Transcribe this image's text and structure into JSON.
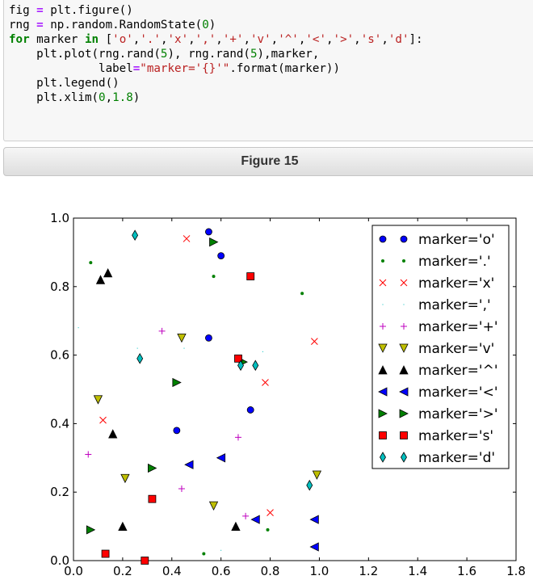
{
  "code": {
    "lines": [
      [
        {
          "t": "fig "
        },
        {
          "t": "=",
          "c": "op"
        },
        {
          "t": " plt.figure()"
        }
      ],
      [
        {
          "t": "rng "
        },
        {
          "t": "=",
          "c": "op"
        },
        {
          "t": " np.random.RandomState("
        },
        {
          "t": "0",
          "c": "num"
        },
        {
          "t": ")"
        }
      ],
      [
        {
          "t": "for",
          "c": "kw"
        },
        {
          "t": " marker "
        },
        {
          "t": "in",
          "c": "kw"
        },
        {
          "t": " ["
        },
        {
          "t": "'o'",
          "c": "str"
        },
        {
          "t": ","
        },
        {
          "t": "'.'",
          "c": "str"
        },
        {
          "t": ","
        },
        {
          "t": "'x'",
          "c": "str"
        },
        {
          "t": ","
        },
        {
          "t": "','",
          "c": "str"
        },
        {
          "t": ","
        },
        {
          "t": "'+'",
          "c": "str"
        },
        {
          "t": ","
        },
        {
          "t": "'v'",
          "c": "str"
        },
        {
          "t": ","
        },
        {
          "t": "'^'",
          "c": "str"
        },
        {
          "t": ","
        },
        {
          "t": "'<'",
          "c": "str"
        },
        {
          "t": ","
        },
        {
          "t": "'>'",
          "c": "str"
        },
        {
          "t": ","
        },
        {
          "t": "'s'",
          "c": "str"
        },
        {
          "t": ","
        },
        {
          "t": "'d'",
          "c": "str"
        },
        {
          "t": "]:"
        }
      ],
      [
        {
          "t": "    plt.plot(rng.rand("
        },
        {
          "t": "5",
          "c": "num"
        },
        {
          "t": "), rng.rand("
        },
        {
          "t": "5",
          "c": "num"
        },
        {
          "t": "),marker,"
        }
      ],
      [
        {
          "t": "             label"
        },
        {
          "t": "=",
          "c": "op"
        },
        {
          "t": "\"marker='{}'\"",
          "c": "str"
        },
        {
          "t": ".format(marker))"
        }
      ],
      [
        {
          "t": "    plt.legend()"
        }
      ],
      [
        {
          "t": "    plt.xlim("
        },
        {
          "t": "0",
          "c": "num"
        },
        {
          "t": ","
        },
        {
          "t": "1.8",
          "c": "num"
        },
        {
          "t": ")"
        }
      ]
    ]
  },
  "figure_header": "Figure 15",
  "chart_data": {
    "type": "scatter",
    "xlim": [
      0,
      1.8
    ],
    "ylim": [
      0,
      1.0
    ],
    "xticks": [
      "0.0",
      "0.2",
      "0.4",
      "0.6",
      "0.8",
      "1.0",
      "1.2",
      "1.4",
      "1.6",
      "1.8"
    ],
    "yticks": [
      "0.0",
      "0.2",
      "0.4",
      "0.6",
      "0.8",
      "1.0"
    ],
    "legend_position": "top-right",
    "series": [
      {
        "name": "marker='o'",
        "marker": "o",
        "color": "#0000ff",
        "x": [
          0.55,
          0.42,
          0.72,
          0.6,
          0.55
        ],
        "y": [
          0.96,
          0.38,
          0.44,
          0.89,
          0.65
        ]
      },
      {
        "name": "marker='.'",
        "marker": ".",
        "color": "#008000",
        "x": [
          0.07,
          0.57,
          0.93,
          0.79,
          0.53
        ],
        "y": [
          0.87,
          0.83,
          0.78,
          0.09,
          0.02
        ]
      },
      {
        "name": "marker='x'",
        "marker": "x",
        "color": "#ff0000",
        "x": [
          0.46,
          0.78,
          0.98,
          0.12,
          0.8
        ],
        "y": [
          0.94,
          0.52,
          0.64,
          0.41,
          0.14
        ]
      },
      {
        "name": "marker=','",
        "marker": ",",
        "color": "#00bfbf",
        "x": [
          0.02,
          0.26,
          0.45,
          0.77,
          0.6
        ],
        "y": [
          0.68,
          0.62,
          0.62,
          0.61,
          0.03
        ]
      },
      {
        "name": "marker='+'",
        "marker": "+",
        "color": "#bf00bf",
        "x": [
          0.36,
          0.67,
          0.44,
          0.7,
          0.06
        ],
        "y": [
          0.67,
          0.36,
          0.21,
          0.13,
          0.31
        ]
      },
      {
        "name": "marker='v'",
        "marker": "v",
        "color": "#bfbf00",
        "x": [
          0.44,
          0.1,
          0.21,
          0.57,
          0.99
        ],
        "y": [
          0.65,
          0.47,
          0.24,
          0.16,
          0.25
        ]
      },
      {
        "name": "marker='^'",
        "marker": "^",
        "color": "#000000",
        "x": [
          0.11,
          0.14,
          0.16,
          0.2,
          0.66
        ],
        "y": [
          0.82,
          0.84,
          0.37,
          0.1,
          0.1
        ]
      },
      {
        "name": "marker='<'",
        "marker": "<",
        "color": "#0000ff",
        "x": [
          0.47,
          0.6,
          0.74,
          0.98,
          0.98
        ],
        "y": [
          0.28,
          0.3,
          0.12,
          0.12,
          0.04
        ]
      },
      {
        "name": "marker='>'",
        "marker": ">",
        "color": "#008000",
        "x": [
          0.57,
          0.42,
          0.69,
          0.32,
          0.07
        ],
        "y": [
          0.93,
          0.52,
          0.58,
          0.27,
          0.09
        ]
      },
      {
        "name": "marker='s'",
        "marker": "s",
        "color": "#ff0000",
        "x": [
          0.72,
          0.67,
          0.32,
          0.13,
          0.29
        ],
        "y": [
          0.83,
          0.59,
          0.18,
          0.02,
          0.0
        ]
      },
      {
        "name": "marker='d'",
        "marker": "d",
        "color": "#00bfbf",
        "x": [
          0.25,
          0.27,
          0.68,
          0.74,
          0.96
        ],
        "y": [
          0.95,
          0.59,
          0.57,
          0.57,
          0.22
        ]
      }
    ]
  }
}
